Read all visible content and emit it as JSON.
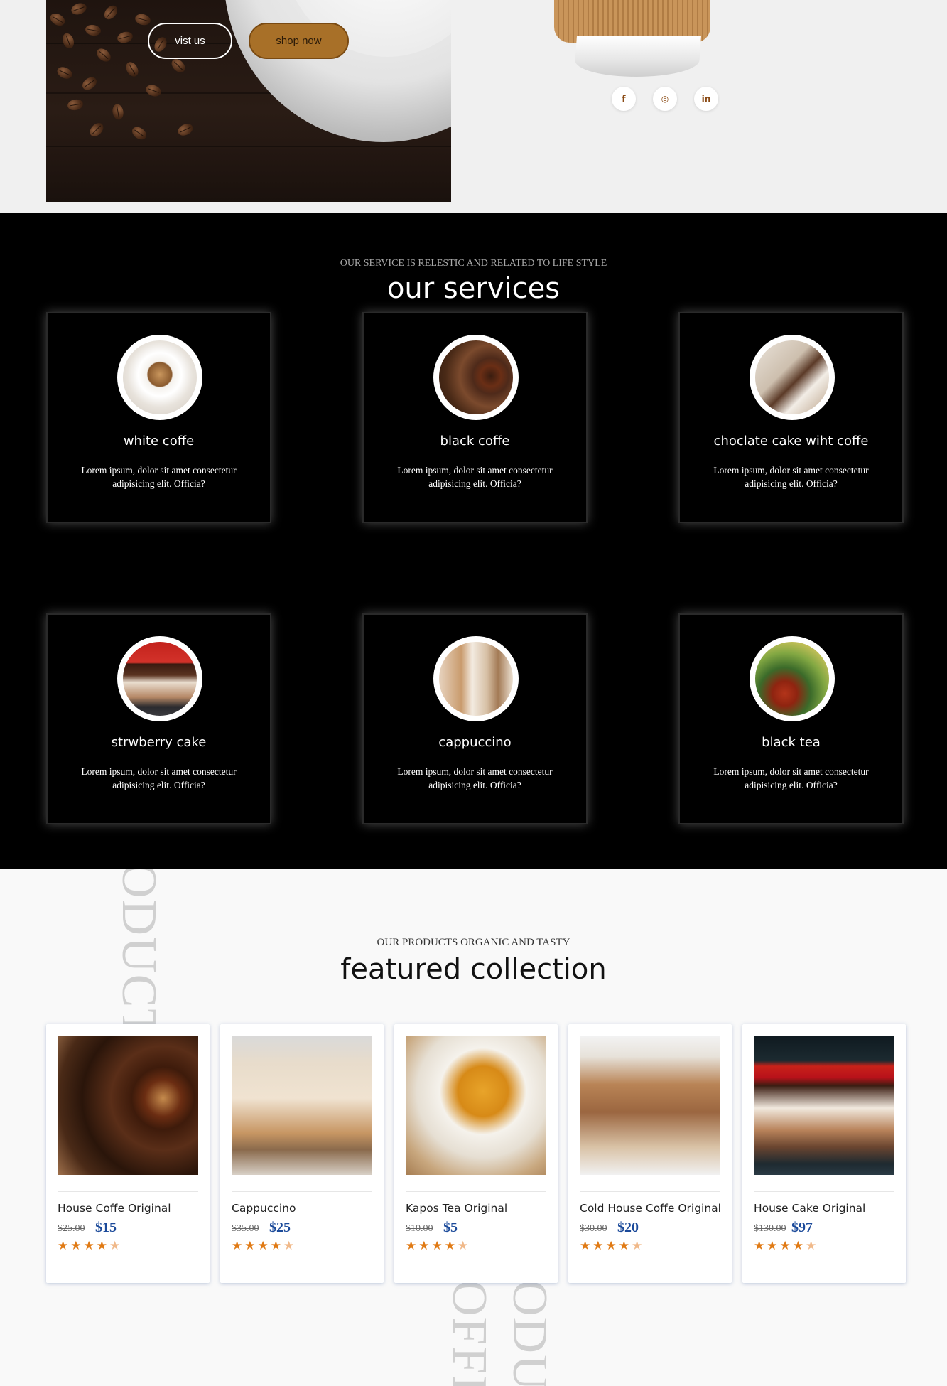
{
  "hero": {
    "visit_label": "vist us",
    "shop_label": "shop now",
    "social": [
      {
        "icon": "facebook-icon",
        "glyph": "f"
      },
      {
        "icon": "instagram-icon",
        "glyph": "◎"
      },
      {
        "icon": "linkedin-icon",
        "glyph": "in"
      }
    ]
  },
  "services": {
    "subtitle": "OUR SERVICE IS RELESTIC AND RELATED TO LIFE STYLE",
    "title": "our services",
    "items": [
      {
        "name": "white coffe",
        "desc": "Lorem ipsum, dolor sit amet consectetur adipisicing elit. Officia?"
      },
      {
        "name": "black coffe",
        "desc": "Lorem ipsum, dolor sit amet consectetur adipisicing elit. Officia?"
      },
      {
        "name": "choclate cake wiht coffe",
        "desc": "Lorem ipsum, dolor sit amet consectetur adipisicing elit. Officia?"
      },
      {
        "name": "strwberry cake",
        "desc": "Lorem ipsum, dolor sit amet consectetur adipisicing elit. Officia?"
      },
      {
        "name": "cappuccino",
        "desc": "Lorem ipsum, dolor sit amet consectetur adipisicing elit. Officia?"
      },
      {
        "name": "black tea",
        "desc": "Lorem ipsum, dolor sit amet consectetur adipisicing elit. Officia?"
      }
    ]
  },
  "featured": {
    "subtitle": "OUR PRODUCTS ORGANIC AND TASTY",
    "title": "featured collection",
    "watermarks": [
      "ODUCT",
      "OFFI",
      "ODUC"
    ],
    "products": [
      {
        "name": "House Coffe Original",
        "old_price": "$25.00",
        "price": "$15",
        "rating": 4.5
      },
      {
        "name": "Cappuccino",
        "old_price": "$35.00",
        "price": "$25",
        "rating": 4.5
      },
      {
        "name": "Kapos Tea Original",
        "old_price": "$10.00",
        "price": "$5",
        "rating": 4.5
      },
      {
        "name": "Cold House Coffe Original",
        "old_price": "$30.00",
        "price": "$20",
        "rating": 4.5
      },
      {
        "name": "House Cake Original",
        "old_price": "$130.00",
        "price": "$97",
        "rating": 4.5
      }
    ]
  },
  "colors": {
    "accent_brown": "#a87028",
    "price_blue": "#1b4a9a",
    "star_orange": "#e07a14",
    "services_bg": "#000000"
  }
}
